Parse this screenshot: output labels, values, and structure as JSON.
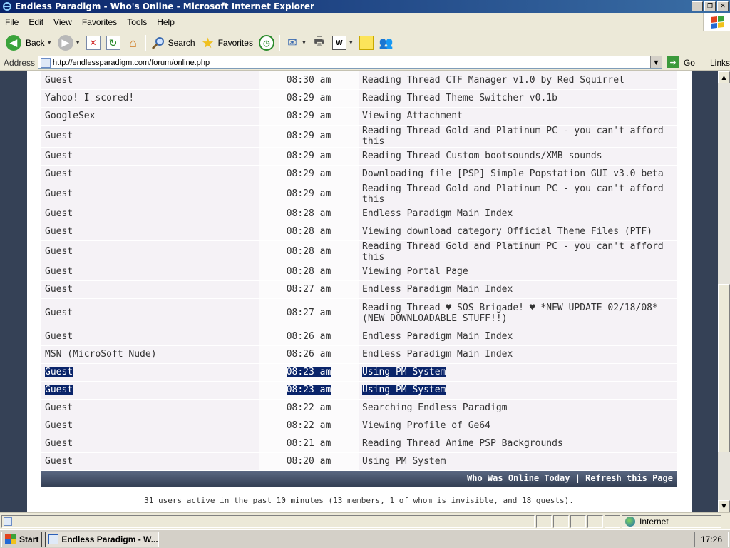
{
  "window": {
    "title": "Endless Paradigm - Who's Online - Microsoft Internet Explorer",
    "buttons": {
      "minimize": "_",
      "maximize": "❐",
      "close": "✕"
    }
  },
  "menu": [
    "File",
    "Edit",
    "View",
    "Favorites",
    "Tools",
    "Help"
  ],
  "toolbar": {
    "back": "Back",
    "search": "Search",
    "favorites": "Favorites"
  },
  "address": {
    "label": "Address",
    "url": "http://endlessparadigm.com/forum/online.php",
    "go": "Go",
    "links": "Links"
  },
  "online": {
    "rows": [
      {
        "user": "Guest",
        "time": "08:30 am",
        "location": "Reading Thread CTF Manager v1.0 by Red Squirrel"
      },
      {
        "user": "Yahoo! I scored!",
        "time": "08:29 am",
        "location": "Reading Thread Theme Switcher v0.1b"
      },
      {
        "user": "GoogleSex",
        "time": "08:29 am",
        "location": "Viewing Attachment"
      },
      {
        "user": "Guest",
        "time": "08:29 am",
        "location": "Reading Thread Gold and Platinum PC - you can't afford this"
      },
      {
        "user": "Guest",
        "time": "08:29 am",
        "location": "Reading Thread Custom bootsounds/XMB sounds"
      },
      {
        "user": "Guest",
        "time": "08:29 am",
        "location": "Downloading file [PSP] Simple Popstation GUI v3.0 beta"
      },
      {
        "user": "Guest",
        "time": "08:29 am",
        "location": "Reading Thread Gold and Platinum PC - you can't afford this"
      },
      {
        "user": "Guest",
        "time": "08:28 am",
        "location": "Endless Paradigm Main Index"
      },
      {
        "user": "Guest",
        "time": "08:28 am",
        "location": "Viewing download category Official Theme Files (PTF)"
      },
      {
        "user": "Guest",
        "time": "08:28 am",
        "location": "Reading Thread Gold and Platinum PC - you can't afford this"
      },
      {
        "user": "Guest",
        "time": "08:28 am",
        "location": "Viewing Portal Page"
      },
      {
        "user": "Guest",
        "time": "08:27 am",
        "location": "Endless Paradigm Main Index"
      },
      {
        "user": "Guest",
        "time": "08:27 am",
        "location": "Reading Thread ♥ SOS Brigade! ♥ *NEW UPDATE 02/18/08* (NEW DOWNLOADABLE STUFF!!)"
      },
      {
        "user": "Guest",
        "time": "08:26 am",
        "location": "Endless Paradigm Main Index"
      },
      {
        "user": "MSN (MicroSoft Nude)",
        "time": "08:26 am",
        "location": "Endless Paradigm Main Index"
      },
      {
        "user": "Guest",
        "time": "08:23 am",
        "location": "Using PM System"
      },
      {
        "user": "Guest",
        "time": "08:23 am",
        "location": "Using PM System"
      },
      {
        "user": "Guest",
        "time": "08:22 am",
        "location": "Searching Endless Paradigm"
      },
      {
        "user": "Guest",
        "time": "08:22 am",
        "location": "Viewing Profile of Ge64"
      },
      {
        "user": "Guest",
        "time": "08:21 am",
        "location": "Reading Thread Anime PSP Backgrounds"
      },
      {
        "user": "Guest",
        "time": "08:20 am",
        "location": "Using PM System"
      }
    ],
    "footer_links": "Who Was Online Today | Refresh this Page",
    "active_summary": "31 users active in the past 10 minutes (13 members, 1 of whom is invisible, and 18 guests)."
  },
  "status": {
    "zone": "Internet"
  },
  "taskbar": {
    "start": "Start",
    "task": "Endless Paradigm - W...",
    "clock": "17:26"
  },
  "colors": {
    "selection": "#0a246a",
    "forum_dark": "#354156",
    "row_light": "#f5f2f6"
  }
}
